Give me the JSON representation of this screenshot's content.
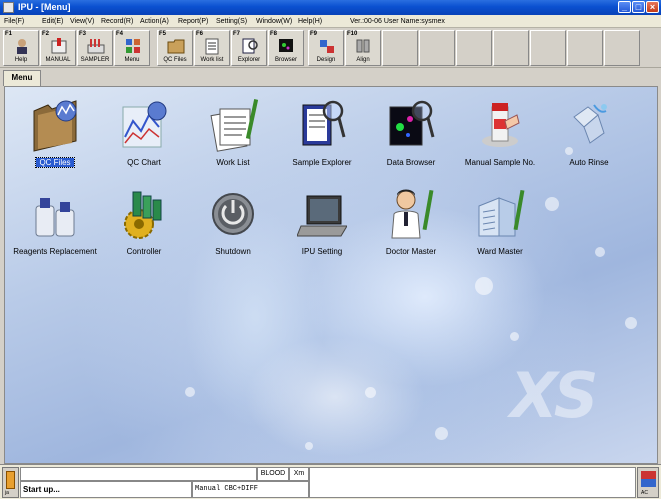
{
  "window": {
    "title": "IPU - [Menu]",
    "minimize_glyph": "_",
    "maximize_glyph": "□",
    "close_glyph": "×"
  },
  "menubar": {
    "items": [
      "File(F)",
      "Edit(E)",
      "View(V)",
      "Record(R)",
      "Action(A)",
      "Report(P)",
      "Setting(S)",
      "Window(W)",
      "Help(H)"
    ],
    "version": "Ver.:00-06 User Name:sysmex"
  },
  "toolbar": {
    "buttons": [
      {
        "key": "F1",
        "label": "Help",
        "icon": "help-icon"
      },
      {
        "key": "F2",
        "label": "MANUAL",
        "icon": "manual-icon"
      },
      {
        "key": "F3",
        "label": "SAMPLER",
        "icon": "sampler-icon"
      },
      {
        "key": "F4",
        "label": "Menu",
        "icon": "menu-icon"
      },
      {
        "key": "F5",
        "label": "QC Files",
        "icon": "qc-files-icon"
      },
      {
        "key": "F6",
        "label": "Work list",
        "icon": "work-list-icon"
      },
      {
        "key": "F7",
        "label": "Explorer",
        "icon": "explorer-icon"
      },
      {
        "key": "F8",
        "label": "Browser",
        "icon": "browser-icon"
      },
      {
        "key": "F9",
        "label": "Design",
        "icon": "design-icon"
      },
      {
        "key": "F10",
        "label": "Align",
        "icon": "align-icon"
      }
    ]
  },
  "tabs": {
    "active": "Menu"
  },
  "desktop": {
    "logo": "XS",
    "icons": [
      {
        "label": "QC Files",
        "icon": "qc-files-folder-icon",
        "selected": true
      },
      {
        "label": "QC Chart",
        "icon": "qc-chart-icon"
      },
      {
        "label": "Work List",
        "icon": "work-list-icon"
      },
      {
        "label": "Sample Explorer",
        "icon": "sample-explorer-icon"
      },
      {
        "label": "Data Browser",
        "icon": "data-browser-icon"
      },
      {
        "label": "Manual Sample No.",
        "icon": "manual-sample-no-icon"
      },
      {
        "label": "Auto Rinse",
        "icon": "auto-rinse-icon"
      },
      {
        "label": "Reagents Replacement",
        "icon": "reagents-replacement-icon"
      },
      {
        "label": "Controller",
        "icon": "controller-icon"
      },
      {
        "label": "Shutdown",
        "icon": "shutdown-icon"
      },
      {
        "label": "IPU Setting",
        "icon": "ipu-setting-icon"
      },
      {
        "label": "Doctor Master",
        "icon": "doctor-master-icon"
      },
      {
        "label": "Ward Master",
        "icon": "ward-master-icon"
      }
    ]
  },
  "statusbar": {
    "message_top": "",
    "blood": "BLOOD",
    "xm": "Xm",
    "startup": "Start up...",
    "mode": "Manual  CBC+DIFF",
    "left_icon_label": "ja",
    "right_icon_label": "AC"
  },
  "colors": {
    "titlebar": "#0a50d0",
    "selection": "#2a5bd0",
    "desktop_bg": "#b9cbe8"
  }
}
